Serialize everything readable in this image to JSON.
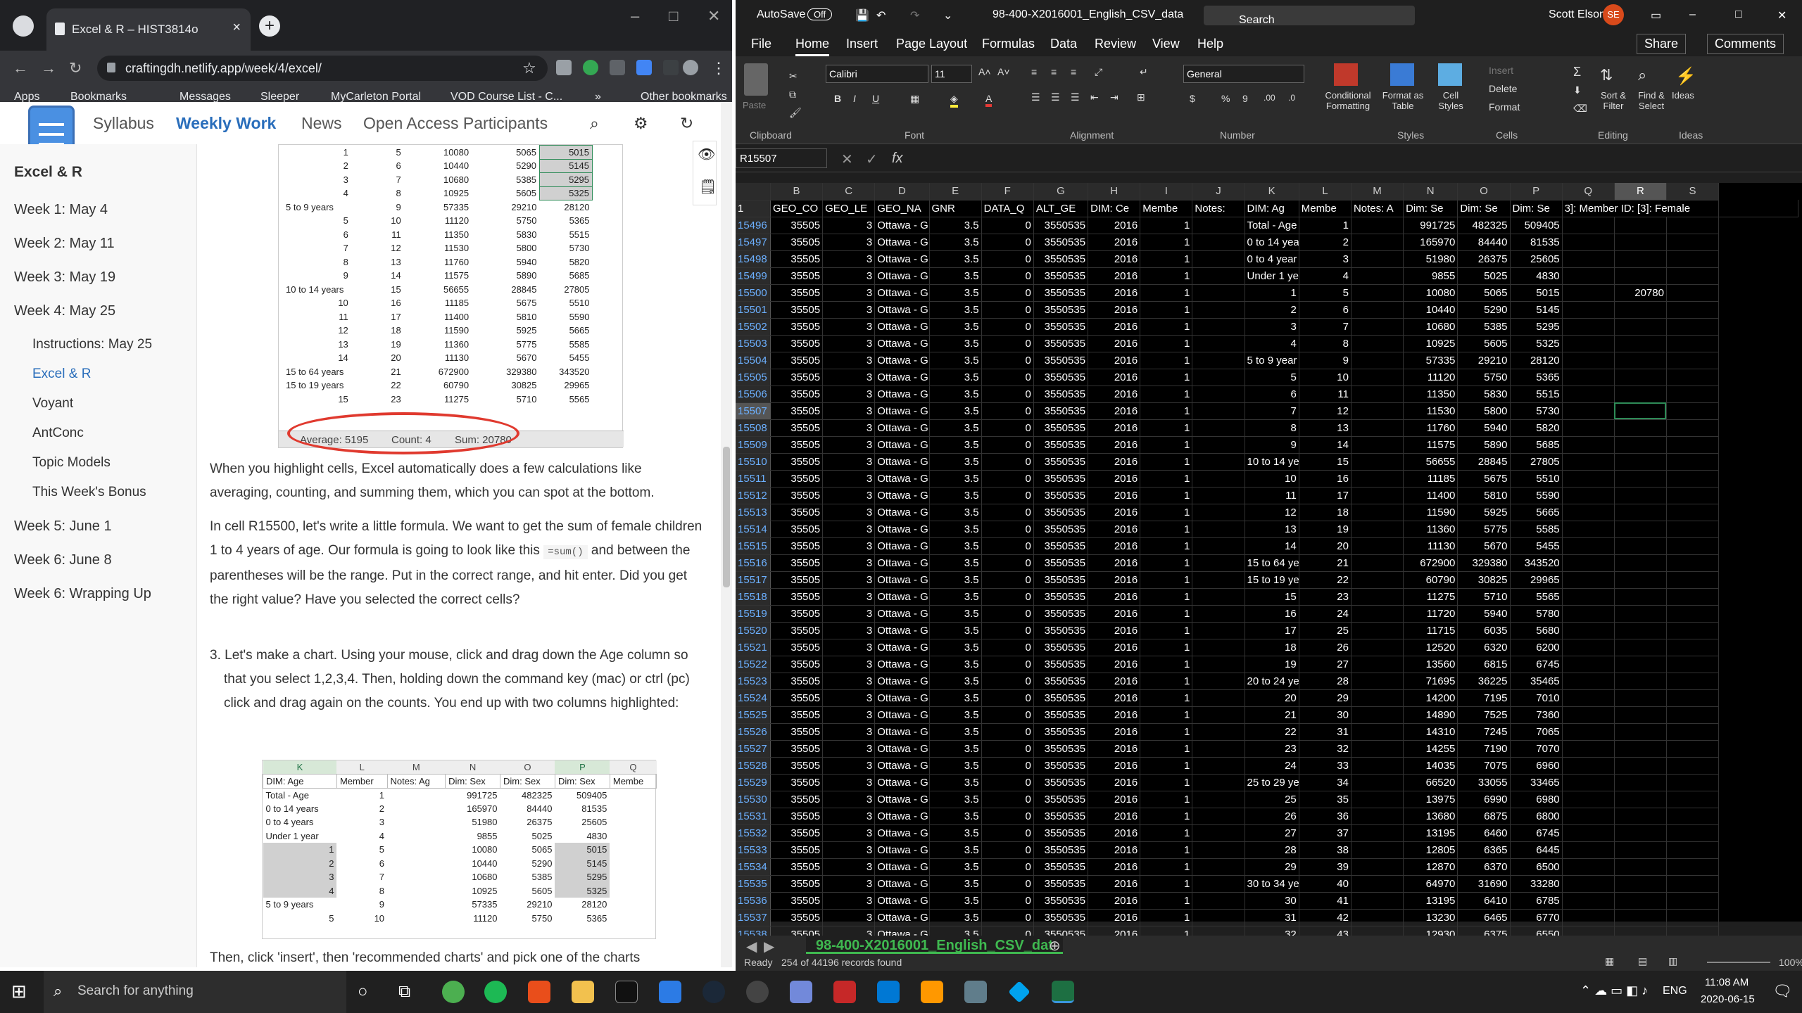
{
  "browser": {
    "tab_title": "Excel & R – HIST3814o",
    "url": "craftingdh.netlify.app/week/4/excel/",
    "bookmarks": [
      "Apps",
      "Bookmarks",
      "Messages",
      "Sleeper",
      "MyCarleton Portal",
      "VOD Course List - C...",
      "»",
      "Other bookmarks"
    ]
  },
  "site": {
    "nav": [
      "Syllabus",
      "Weekly Work",
      "News",
      "Open Access Participants"
    ],
    "sidebar_title": "Excel & R",
    "weeks": [
      "Week 1: May 4",
      "Week 2: May 11",
      "Week 3: May 19",
      "Week 4: May 25"
    ],
    "week4_items": [
      "Instructions: May 25",
      "Excel & R",
      "Voyant",
      "AntConc",
      "Topic Models",
      "This Week's Bonus"
    ],
    "later_weeks": [
      "Week 5: June 1",
      "Week 6: June 8",
      "Week 6: Wrapping Up"
    ]
  },
  "shot1": {
    "rows": [
      [
        "1",
        "5",
        "10080",
        "5065",
        "5015"
      ],
      [
        "2",
        "6",
        "10440",
        "5290",
        "5145"
      ],
      [
        "3",
        "7",
        "10680",
        "5385",
        "5295"
      ],
      [
        "4",
        "8",
        "10925",
        "5605",
        "5325"
      ],
      [
        "5 to 9 years",
        "9",
        "57335",
        "29210",
        "28120"
      ],
      [
        "5",
        "10",
        "11120",
        "5750",
        "5365"
      ],
      [
        "6",
        "11",
        "11350",
        "5830",
        "5515"
      ],
      [
        "7",
        "12",
        "11530",
        "5800",
        "5730"
      ],
      [
        "8",
        "13",
        "11760",
        "5940",
        "5820"
      ],
      [
        "9",
        "14",
        "11575",
        "5890",
        "5685"
      ],
      [
        "10 to 14 years",
        "15",
        "56655",
        "28845",
        "27805"
      ],
      [
        "10",
        "16",
        "11185",
        "5675",
        "5510"
      ],
      [
        "11",
        "17",
        "11400",
        "5810",
        "5590"
      ],
      [
        "12",
        "18",
        "11590",
        "5925",
        "5665"
      ],
      [
        "13",
        "19",
        "11360",
        "5775",
        "5585"
      ],
      [
        "14",
        "20",
        "11130",
        "5670",
        "5455"
      ],
      [
        "15 to 64 years",
        "21",
        "672900",
        "329380",
        "343520"
      ],
      [
        "15 to 19 years",
        "22",
        "60790",
        "30825",
        "29965"
      ],
      [
        "15",
        "23",
        "11275",
        "5710",
        "5565"
      ]
    ],
    "status": [
      "Average: 5195",
      "Count: 4",
      "Sum: 20780"
    ]
  },
  "text": {
    "p1": "When you highlight cells, Excel automatically does a few calculations like averaging, counting, and summing them, which you can spot at the bottom.",
    "p2a": "In cell R15500, let's write a little formula. We want to get the sum of female children 1 to 4 years of age. Our formula is going to look like this",
    "p2code": "=sum()",
    "p2b": "and between the parentheses will be the range. Put in the correct range, and hit enter. Did you get the right value? Have you selected the correct cells?",
    "p3": "3. Let's make a chart. Using your mouse, click and drag down the Age column so that you select 1,2,3,4. Then, holding down the command key (mac) or ctrl (pc) click and drag again on the counts. You end up with two columns highlighted:",
    "p4": "Then, click 'insert', then 'recommended charts' and pick one of the charts"
  },
  "shot2": {
    "cols": [
      "K",
      "L",
      "M",
      "N",
      "O",
      "P",
      "Q"
    ],
    "headers": [
      "DIM: Age",
      "Member",
      "Notes: Ag",
      "Dim: Sex",
      "Dim: Sex",
      "Dim: Sex",
      "Membe"
    ],
    "rows": [
      [
        "Total - Age",
        "1",
        "",
        "991725",
        "482325",
        "509405"
      ],
      [
        "0 to 14 years",
        "2",
        "",
        "165970",
        "84440",
        "81535"
      ],
      [
        "0 to 4 years",
        "3",
        "",
        "51980",
        "26375",
        "25605"
      ],
      [
        "Under 1 year",
        "4",
        "",
        "9855",
        "5025",
        "4830"
      ],
      [
        "1",
        "5",
        "",
        "10080",
        "5065",
        "5015"
      ],
      [
        "2",
        "6",
        "",
        "10440",
        "5290",
        "5145"
      ],
      [
        "3",
        "7",
        "",
        "10680",
        "5385",
        "5295"
      ],
      [
        "4",
        "8",
        "",
        "10925",
        "5605",
        "5325"
      ],
      [
        "5 to 9 years",
        "9",
        "",
        "57335",
        "29210",
        "28120"
      ],
      [
        "5",
        "10",
        "",
        "11120",
        "5750",
        "5365"
      ]
    ]
  },
  "excel": {
    "autosave": "AutoSave",
    "autosave_state": "Off",
    "filename": "98-400-X2016001_English_CSV_data",
    "search": "Search",
    "user": "Scott Elson",
    "initials": "SE",
    "menu": [
      "File",
      "Home",
      "Insert",
      "Page Layout",
      "Formulas",
      "Data",
      "Review",
      "View",
      "Help"
    ],
    "share": "Share",
    "comments": "Comments",
    "font": "Calibri",
    "font_size": "11",
    "number_format": "General",
    "groups": [
      "Clipboard",
      "Font",
      "Alignment",
      "Number",
      "Styles",
      "Cells",
      "Editing",
      "Ideas"
    ],
    "ribbon_labels": [
      "Paste",
      "Conditional Formatting",
      "Format as Table",
      "Cell Styles",
      "Insert",
      "Delete",
      "Format",
      "Sort & Filter",
      "Find & Select",
      "Ideas"
    ],
    "namebox": "R15507",
    "fx": "fx",
    "columns": [
      "B",
      "C",
      "D",
      "E",
      "F",
      "G",
      "H",
      "I",
      "J",
      "K",
      "L",
      "M",
      "N",
      "O",
      "P",
      "Q",
      "R",
      "S"
    ],
    "filter_headers": [
      "GEO_CO",
      "GEO_LE",
      "GEO_NA",
      "GNR",
      "DATA_Q",
      "ALT_GE",
      "DIM: Ce",
      "Membe",
      "Notes: ",
      "DIM: Ag",
      "Membe",
      "Notes: A",
      "Dim: Se",
      "Dim: Se",
      "Dim: Se",
      "3]: Member ID: [3]: Female",
      "",
      ""
    ],
    "r15500": "20780",
    "rows": [
      [
        "15496",
        "Total - Age",
        "1",
        "991725",
        "482325",
        "509405"
      ],
      [
        "15497",
        "0 to 14 yea",
        "2",
        "165970",
        "84440",
        "81535"
      ],
      [
        "15498",
        "0 to 4 year",
        "3",
        "51980",
        "26375",
        "25605"
      ],
      [
        "15499",
        "Under 1 ye",
        "4",
        "9855",
        "5025",
        "4830"
      ],
      [
        "15500",
        "1",
        "5",
        "10080",
        "5065",
        "5015"
      ],
      [
        "15501",
        "2",
        "6",
        "10440",
        "5290",
        "5145"
      ],
      [
        "15502",
        "3",
        "7",
        "10680",
        "5385",
        "5295"
      ],
      [
        "15503",
        "4",
        "8",
        "10925",
        "5605",
        "5325"
      ],
      [
        "15504",
        "5 to 9 year",
        "9",
        "57335",
        "29210",
        "28120"
      ],
      [
        "15505",
        "5",
        "10",
        "11120",
        "5750",
        "5365"
      ],
      [
        "15506",
        "6",
        "11",
        "11350",
        "5830",
        "5515"
      ],
      [
        "15507",
        "7",
        "12",
        "11530",
        "5800",
        "5730"
      ],
      [
        "15508",
        "8",
        "13",
        "11760",
        "5940",
        "5820"
      ],
      [
        "15509",
        "9",
        "14",
        "11575",
        "5890",
        "5685"
      ],
      [
        "15510",
        "10 to 14 ye",
        "15",
        "56655",
        "28845",
        "27805"
      ],
      [
        "15511",
        "10",
        "16",
        "11185",
        "5675",
        "5510"
      ],
      [
        "15512",
        "11",
        "17",
        "11400",
        "5810",
        "5590"
      ],
      [
        "15513",
        "12",
        "18",
        "11590",
        "5925",
        "5665"
      ],
      [
        "15514",
        "13",
        "19",
        "11360",
        "5775",
        "5585"
      ],
      [
        "15515",
        "14",
        "20",
        "11130",
        "5670",
        "5455"
      ],
      [
        "15516",
        "15 to 64 ye",
        "21",
        "672900",
        "329380",
        "343520"
      ],
      [
        "15517",
        "15 to 19 ye",
        "22",
        "60790",
        "30825",
        "29965"
      ],
      [
        "15518",
        "15",
        "23",
        "11275",
        "5710",
        "5565"
      ],
      [
        "15519",
        "16",
        "24",
        "11720",
        "5940",
        "5780"
      ],
      [
        "15520",
        "17",
        "25",
        "11715",
        "6035",
        "5680"
      ],
      [
        "15521",
        "18",
        "26",
        "12520",
        "6320",
        "6200"
      ],
      [
        "15522",
        "19",
        "27",
        "13560",
        "6815",
        "6745"
      ],
      [
        "15523",
        "20 to 24 ye",
        "28",
        "71695",
        "36225",
        "35465"
      ],
      [
        "15524",
        "20",
        "29",
        "14200",
        "7195",
        "7010"
      ],
      [
        "15525",
        "21",
        "30",
        "14890",
        "7525",
        "7360"
      ],
      [
        "15526",
        "22",
        "31",
        "14310",
        "7245",
        "7065"
      ],
      [
        "15527",
        "23",
        "32",
        "14255",
        "7190",
        "7070"
      ],
      [
        "15528",
        "24",
        "33",
        "14035",
        "7075",
        "6960"
      ],
      [
        "15529",
        "25 to 29 ye",
        "34",
        "66520",
        "33055",
        "33465"
      ],
      [
        "15530",
        "25",
        "35",
        "13975",
        "6990",
        "6980"
      ],
      [
        "15531",
        "26",
        "36",
        "13680",
        "6875",
        "6800"
      ],
      [
        "15532",
        "27",
        "37",
        "13195",
        "6460",
        "6745"
      ],
      [
        "15533",
        "28",
        "38",
        "12805",
        "6365",
        "6445"
      ],
      [
        "15534",
        "29",
        "39",
        "12870",
        "6370",
        "6500"
      ],
      [
        "15535",
        "30 to 34 ye",
        "40",
        "64970",
        "31690",
        "33280"
      ],
      [
        "15536",
        "30",
        "41",
        "13195",
        "6410",
        "6785"
      ],
      [
        "15537",
        "31",
        "42",
        "13230",
        "6465",
        "6770"
      ],
      [
        "15538",
        "32",
        "43",
        "12930",
        "6375",
        "6550"
      ]
    ],
    "const": {
      "b": "35505",
      "c": "3",
      "d": "Ottawa - G",
      "e": "3.5",
      "f": "0",
      "g": "3550535",
      "h": "2016",
      "i": "1"
    },
    "sheet_tab": "98-400-X2016001_English_CSV_dat",
    "status": [
      "Ready",
      "254 of 44196 records found",
      "100%"
    ]
  },
  "taskbar": {
    "search": "Search for anything",
    "lang": "ENG",
    "time": "11:08 AM",
    "date": "2020-06-15"
  }
}
